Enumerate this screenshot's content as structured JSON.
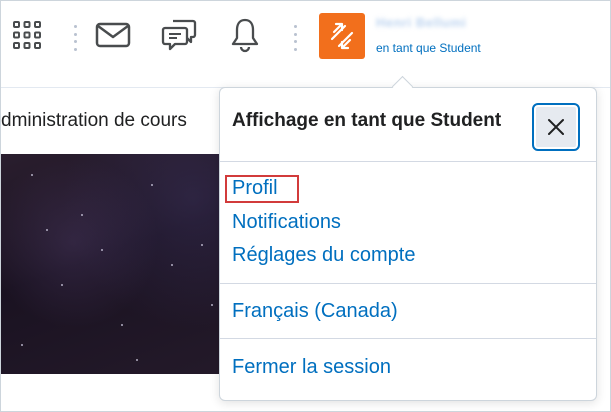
{
  "topbar": {
    "icons": [
      "apps-grid-icon",
      "mail-icon",
      "chat-icon",
      "bell-icon"
    ],
    "role_icon": "switch-arrows-icon",
    "user_name": "Henri Bellumi",
    "user_role": "en tant que Student"
  },
  "page": {
    "nav_text": "dministration de cours"
  },
  "popover": {
    "title": "Affichage en tant que Student",
    "close_icon": "close-icon",
    "links": {
      "profile": "Profil",
      "notifications": "Notifications",
      "account_settings": "Réglages du compte",
      "language": "Français (Canada)",
      "logout": "Fermer la session"
    }
  },
  "colors": {
    "accent": "#006fbf",
    "role_tile": "#f26f1c",
    "highlight": "#d23b3b",
    "text": "#202122"
  }
}
